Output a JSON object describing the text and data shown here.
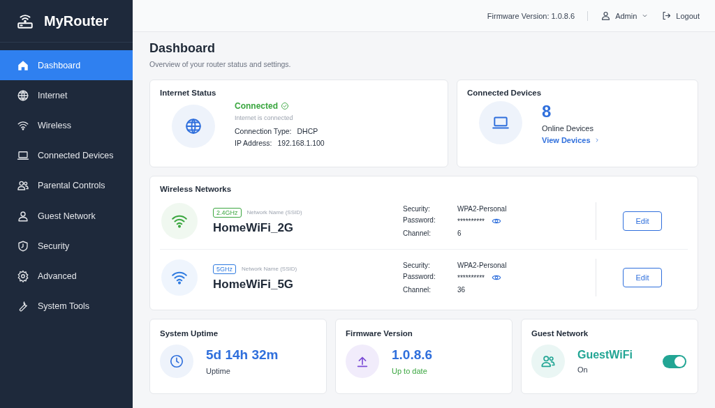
{
  "brand": "MyRouter",
  "nav": [
    {
      "label": "Dashboard",
      "selected": true
    },
    {
      "label": "Internet",
      "selected": false
    },
    {
      "label": "Wireless",
      "selected": false
    },
    {
      "label": "Connected Devices",
      "selected": false
    },
    {
      "label": "Parental Controls",
      "selected": false
    },
    {
      "label": "Guest Network",
      "selected": false
    },
    {
      "label": "Security",
      "selected": false
    },
    {
      "label": "Advanced",
      "selected": false
    },
    {
      "label": "System Tools",
      "selected": false
    }
  ],
  "topbar": {
    "firmware": "Firmware Version: 1.0.8.6",
    "user": "Admin",
    "logout": "Logout"
  },
  "page": {
    "title": "Dashboard",
    "subtitle": "Overview of your router status and settings."
  },
  "internet": {
    "title": "Internet Status",
    "status": "Connected",
    "detail": "Internet is connected",
    "rows": [
      {
        "label": "Connection Type:",
        "value": "DHCP"
      },
      {
        "label": "IP Address:",
        "value": "192.168.1.100"
      }
    ]
  },
  "devices": {
    "title": "Connected Devices",
    "count": "8",
    "label": "Online Devices",
    "link": "View Devices"
  },
  "wireless": {
    "title": "Wireless Networks",
    "networks": [
      {
        "band": "2.4GHz",
        "color": "#3aa63f",
        "ssid_label": "Network Name (SSID)",
        "ssid": "HomeWiFi_2G",
        "details": [
          {
            "label": "Security:",
            "value": "WPA2-Personal",
            "kind": "text"
          },
          {
            "label": "Password:",
            "value": "**********",
            "kind": "password"
          },
          {
            "label": "Channel:",
            "value": "6",
            "kind": "text"
          }
        ],
        "edit": "Edit"
      },
      {
        "band": "5GHz",
        "color": "#2f7be0",
        "ssid_label": "Network Name (SSID)",
        "ssid": "HomeWiFi_5G",
        "details": [
          {
            "label": "Security:",
            "value": "WPA2-Personal",
            "kind": "text"
          },
          {
            "label": "Password:",
            "value": "**********",
            "kind": "password"
          },
          {
            "label": "Channel:",
            "value": "36",
            "kind": "text"
          }
        ],
        "edit": "Edit"
      }
    ]
  },
  "stats": [
    {
      "kind": "uptime",
      "title": "System Uptime",
      "value": "5d 14h 32m",
      "label": "Uptime"
    },
    {
      "kind": "firmware",
      "title": "Firmware Version",
      "value": "1.0.8.6",
      "label": "Up to date"
    },
    {
      "kind": "guest",
      "title": "Guest Network",
      "value": "GuestWiFi",
      "label": "On",
      "on": true
    }
  ]
}
